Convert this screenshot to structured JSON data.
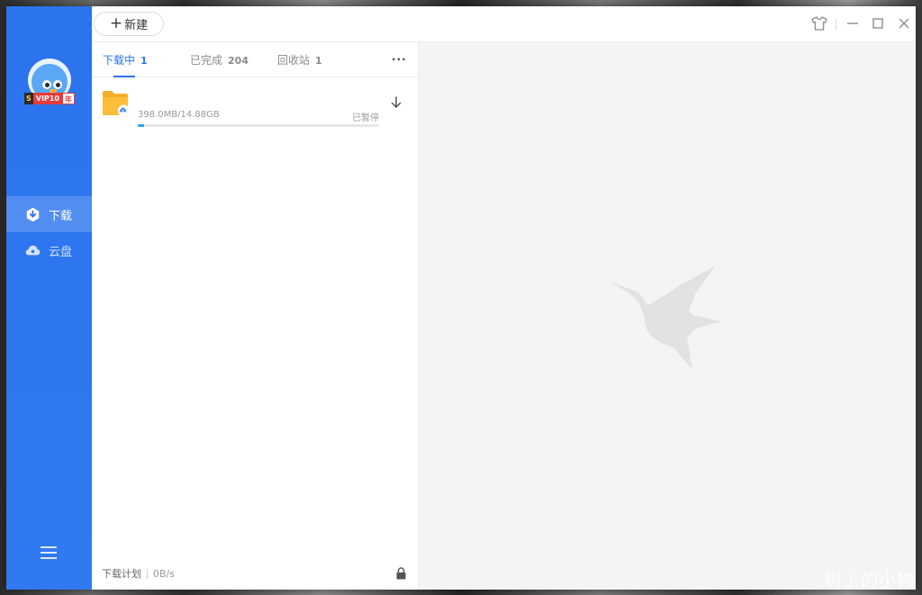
{
  "app": {
    "accent_color": "#2c74ee",
    "sidebar_color": "#3079f0"
  },
  "user": {
    "avatar_icon": "bird-mascot-icon",
    "vip_badge": {
      "prefix": "S",
      "label": "VIP10",
      "suffix": "年"
    }
  },
  "sidebar": {
    "items": [
      {
        "label": "下载",
        "icon": "download-icon",
        "active": true
      },
      {
        "label": "云盘",
        "icon": "cloud-icon",
        "active": false
      }
    ],
    "menu_icon": "hamburger-menu-icon"
  },
  "toolbar": {
    "new_label": "新建",
    "new_icon": "plus-icon",
    "skin_icon": "tshirt-icon",
    "minimize_icon": "minimize-icon",
    "maximize_icon": "maximize-icon",
    "close_icon": "close-icon"
  },
  "tabs": [
    {
      "label": "下载中",
      "count": "1",
      "active": true
    },
    {
      "label": "已完成",
      "count": "204",
      "active": false
    },
    {
      "label": "回收站",
      "count": "1",
      "active": false
    }
  ],
  "more_label": "···",
  "tasks": [
    {
      "icon": "cloud-folder-icon",
      "size": "398.0MB/14.88GB",
      "status": "已暂停",
      "progress": 0.026
    }
  ],
  "footer": {
    "plan_label": "下载计划",
    "speed": "0B/s",
    "lock_icon": "lock-icon"
  },
  "detail": {
    "placeholder_icon": "hummingbird-logo-icon"
  },
  "watermark": "树上的小狗"
}
